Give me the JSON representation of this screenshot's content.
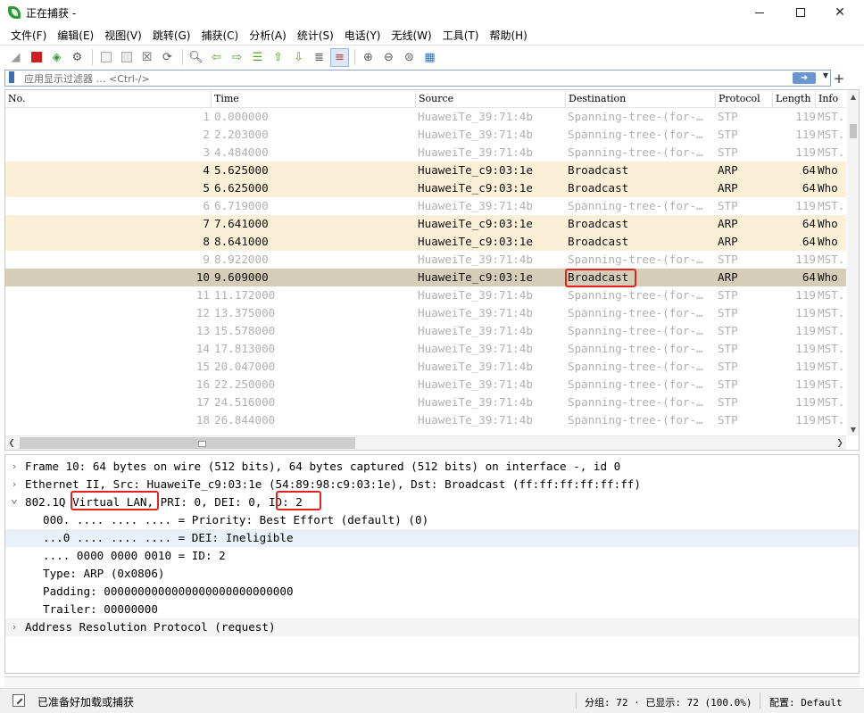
{
  "window": {
    "title": "正在捕获 -"
  },
  "menu": [
    "文件(F)",
    "编辑(E)",
    "视图(V)",
    "跳转(G)",
    "捕获(C)",
    "分析(A)",
    "统计(S)",
    "电话(Y)",
    "无线(W)",
    "工具(T)",
    "帮助(H)"
  ],
  "toolbar": {
    "icons": [
      "shark-fin-start-icon",
      "stop-capture-icon",
      "restart-capture-icon",
      "capture-options-icon",
      "open-file-icon",
      "save-file-icon",
      "close-file-icon",
      "reload-icon",
      "find-packet-icon",
      "go-back-icon",
      "go-forward-icon",
      "go-to-packet-icon",
      "first-packet-icon",
      "last-packet-icon",
      "autoscroll-icon",
      "colorize-icon",
      "zoom-in-icon",
      "zoom-out-icon",
      "zoom-normal-icon",
      "resize-columns-icon"
    ]
  },
  "filter": {
    "placeholder": "应用显示过滤器 … <Ctrl-/>"
  },
  "packet_list": {
    "columns": [
      "No.",
      "Time",
      "Source",
      "Destination",
      "Protocol",
      "Length",
      "Info"
    ],
    "rows": [
      {
        "no": "1",
        "time": "0.000000",
        "src": "HuaweiTe_39:71:4b",
        "dst": "Spanning-tree-(for-…",
        "proto": "STP",
        "len": "119",
        "info": "MST.",
        "kind": "stp"
      },
      {
        "no": "2",
        "time": "2.203000",
        "src": "HuaweiTe_39:71:4b",
        "dst": "Spanning-tree-(for-…",
        "proto": "STP",
        "len": "119",
        "info": "MST.",
        "kind": "stp"
      },
      {
        "no": "3",
        "time": "4.484000",
        "src": "HuaweiTe_39:71:4b",
        "dst": "Spanning-tree-(for-…",
        "proto": "STP",
        "len": "119",
        "info": "MST.",
        "kind": "stp"
      },
      {
        "no": "4",
        "time": "5.625000",
        "src": "HuaweiTe_c9:03:1e",
        "dst": "Broadcast",
        "proto": "ARP",
        "len": "64",
        "info": "Who",
        "kind": "arp"
      },
      {
        "no": "5",
        "time": "6.625000",
        "src": "HuaweiTe_c9:03:1e",
        "dst": "Broadcast",
        "proto": "ARP",
        "len": "64",
        "info": "Who",
        "kind": "arp"
      },
      {
        "no": "6",
        "time": "6.719000",
        "src": "HuaweiTe_39:71:4b",
        "dst": "Spanning-tree-(for-…",
        "proto": "STP",
        "len": "119",
        "info": "MST.",
        "kind": "stp"
      },
      {
        "no": "7",
        "time": "7.641000",
        "src": "HuaweiTe_c9:03:1e",
        "dst": "Broadcast",
        "proto": "ARP",
        "len": "64",
        "info": "Who",
        "kind": "arp"
      },
      {
        "no": "8",
        "time": "8.641000",
        "src": "HuaweiTe_c9:03:1e",
        "dst": "Broadcast",
        "proto": "ARP",
        "len": "64",
        "info": "Who",
        "kind": "arp"
      },
      {
        "no": "9",
        "time": "8.922000",
        "src": "HuaweiTe_39:71:4b",
        "dst": "Spanning-tree-(for-…",
        "proto": "STP",
        "len": "119",
        "info": "MST.",
        "kind": "stp"
      },
      {
        "no": "10",
        "time": "9.609000",
        "src": "HuaweiTe_c9:03:1e",
        "dst": "Broadcast",
        "proto": "ARP",
        "len": "64",
        "info": "Who",
        "kind": "sel"
      },
      {
        "no": "11",
        "time": "11.172000",
        "src": "HuaweiTe_39:71:4b",
        "dst": "Spanning-tree-(for-…",
        "proto": "STP",
        "len": "119",
        "info": "MST.",
        "kind": "stp"
      },
      {
        "no": "12",
        "time": "13.375000",
        "src": "HuaweiTe_39:71:4b",
        "dst": "Spanning-tree-(for-…",
        "proto": "STP",
        "len": "119",
        "info": "MST.",
        "kind": "stp"
      },
      {
        "no": "13",
        "time": "15.578000",
        "src": "HuaweiTe_39:71:4b",
        "dst": "Spanning-tree-(for-…",
        "proto": "STP",
        "len": "119",
        "info": "MST.",
        "kind": "stp"
      },
      {
        "no": "14",
        "time": "17.813000",
        "src": "HuaweiTe_39:71:4b",
        "dst": "Spanning-tree-(for-…",
        "proto": "STP",
        "len": "119",
        "info": "MST.",
        "kind": "stp"
      },
      {
        "no": "15",
        "time": "20.047000",
        "src": "HuaweiTe_39:71:4b",
        "dst": "Spanning-tree-(for-…",
        "proto": "STP",
        "len": "119",
        "info": "MST.",
        "kind": "stp"
      },
      {
        "no": "16",
        "time": "22.250000",
        "src": "HuaweiTe_39:71:4b",
        "dst": "Spanning-tree-(for-…",
        "proto": "STP",
        "len": "119",
        "info": "MST.",
        "kind": "stp"
      },
      {
        "no": "17",
        "time": "24.516000",
        "src": "HuaweiTe_39:71:4b",
        "dst": "Spanning-tree-(for-…",
        "proto": "STP",
        "len": "119",
        "info": "MST.",
        "kind": "stp"
      },
      {
        "no": "18",
        "time": "26.844000",
        "src": "HuaweiTe_39:71:4b",
        "dst": "Spanning-tree-(for-…",
        "proto": "STP",
        "len": "119",
        "info": "MST.",
        "kind": "stp"
      }
    ]
  },
  "details": [
    {
      "toggle": ">",
      "text": "Frame 10: 64 bytes on wire (512 bits), 64 bytes captured (512 bits) on interface -, id 0",
      "indent": 0,
      "style": "normal"
    },
    {
      "toggle": ">",
      "text": "Ethernet II, Src: HuaweiTe_c9:03:1e (54:89:98:c9:03:1e), Dst: Broadcast (ff:ff:ff:ff:ff:ff)",
      "indent": 0,
      "style": "normal"
    },
    {
      "toggle": "v",
      "text": "802.1Q Virtual LAN, PRI: 0, DEI: 0, ID: 2",
      "indent": 0,
      "style": "normal"
    },
    {
      "toggle": "",
      "text": "000. .... .... .... = Priority: Best Effort (default) (0)",
      "indent": 1,
      "style": "normal"
    },
    {
      "toggle": "",
      "text": "...0 .... .... .... = DEI: Ineligible",
      "indent": 1,
      "style": "hl"
    },
    {
      "toggle": "",
      "text": ".... 0000 0000 0010 = ID: 2",
      "indent": 1,
      "style": "normal"
    },
    {
      "toggle": "",
      "text": "Type: ARP (0x0806)",
      "indent": 1,
      "style": "normal"
    },
    {
      "toggle": "",
      "text": "Padding: 0000000000000000000000000000",
      "indent": 1,
      "style": "normal"
    },
    {
      "toggle": "",
      "text": "Trailer: 00000000",
      "indent": 1,
      "style": "normal"
    },
    {
      "toggle": ">",
      "text": "Address Resolution Protocol (request)",
      "indent": 0,
      "style": "alt"
    }
  ],
  "status": {
    "ready": "已准备好加载或捕获",
    "packets": "分组: 72 · 已显示: 72 (100.0%)",
    "profile": "配置: Default"
  },
  "colors": {
    "arp_row": "#faf0d7",
    "selected_row": "#d6cdb8",
    "stp_text": "#b0b0b0",
    "highlight_box": "#e0231c"
  }
}
